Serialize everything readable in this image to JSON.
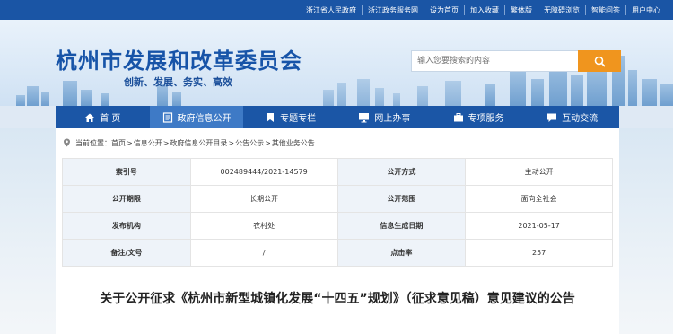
{
  "topbar": {
    "links": [
      "浙江省人民政府",
      "浙江政务服务网",
      "设为首页",
      "加入收藏",
      "繁体版",
      "无障碍浏览",
      "智能问答",
      "用户中心"
    ]
  },
  "header": {
    "title": "杭州市发展和改革委员会",
    "slogan": "创新、发展、务实、高效",
    "search_placeholder": "输入您要搜索的内容"
  },
  "nav": {
    "items": [
      {
        "label": "首 页",
        "icon": "home-icon"
      },
      {
        "label": "政府信息公开",
        "icon": "document-icon"
      },
      {
        "label": "专题专栏",
        "icon": "bookmark-icon"
      },
      {
        "label": "网上办事",
        "icon": "monitor-icon"
      },
      {
        "label": "专项服务",
        "icon": "briefcase-icon"
      },
      {
        "label": "互动交流",
        "icon": "chat-icon"
      }
    ],
    "active_index": 1
  },
  "breadcrumb": {
    "prefix": "当前位置：",
    "items": [
      "首页",
      "信息公开",
      "政府信息公开目录",
      "公告公示",
      "其他业务公告"
    ],
    "separator": ">"
  },
  "info_table": {
    "rows": [
      {
        "k1": "索引号",
        "v1": "002489444/2021-14579",
        "k2": "公开方式",
        "v2": "主动公开"
      },
      {
        "k1": "公开期限",
        "v1": "长期公开",
        "k2": "公开范围",
        "v2": "面向全社会"
      },
      {
        "k1": "发布机构",
        "v1": "农村处",
        "k2": "信息生成日期",
        "v2": "2021-05-17"
      },
      {
        "k1": "备注/文号",
        "v1": "/",
        "k2": "点击率",
        "v2": "257"
      }
    ]
  },
  "article": {
    "title": "关于公开征求《杭州市新型城镇化发展“十四五”规划》（征求意见稿）意见建议的公告"
  },
  "colors": {
    "primary": "#1b56a6",
    "topbar": "#1a55a5",
    "search_button": "#f0951e",
    "nav_active": "#3e7ac6"
  }
}
